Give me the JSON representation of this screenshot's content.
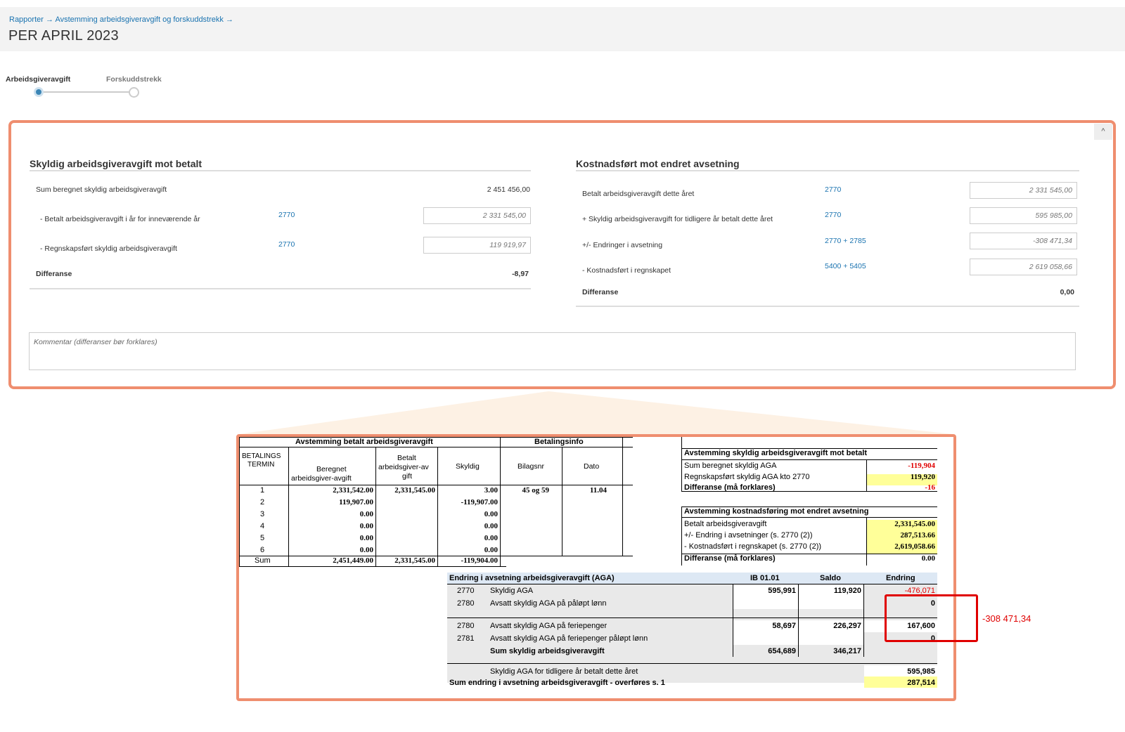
{
  "breadcrumb": {
    "item1": "Rapporter",
    "item2": "Avstemming arbeidsgiveravgift og forskuddstrekk",
    "arrow": "→"
  },
  "page_title": "PER APRIL 2023",
  "steps": [
    {
      "label": "Arbeidsgiveravgift",
      "active": true
    },
    {
      "label": "Forskuddstrekk",
      "active": false
    }
  ],
  "left_section": {
    "title": "Skyldig arbeidsgiveravgift mot betalt",
    "rows": [
      {
        "label": "Sum beregnet skyldig arbeidsgiveravgift",
        "account": "",
        "value": "2 451 456,00"
      },
      {
        "label": "- Betalt arbeidsgiveravgift i år for inneværende år",
        "account": "2770",
        "value": "2 331 545,00"
      },
      {
        "label": "- Regnskapsført skyldig arbeidsgiveravgift",
        "account": "2770",
        "value": "119 919,97"
      },
      {
        "label": "Differanse",
        "account": "",
        "value": "-8,97"
      }
    ]
  },
  "right_section": {
    "title": "Kostnadsført mot endret avsetning",
    "rows": [
      {
        "label": "Betalt arbeidsgiveravgift dette året",
        "account": "2770",
        "value": "2 331 545,00"
      },
      {
        "label": "+ Skyldig arbeidsgiveravgift for tidligere år betalt dette året",
        "account": "2770",
        "value": "595 985,00"
      },
      {
        "label": "+/- Endringer i avsetning",
        "account": "2770 + 2785",
        "value": "-308 471,34"
      },
      {
        "label": "- Kostnadsført i regnskapet",
        "account": "5400 + 5405",
        "value": "2 619 058,66"
      },
      {
        "label": "Differanse",
        "account": "",
        "value": "0,00"
      }
    ]
  },
  "comment_placeholder": "Kommentar (differanser bør forklares)",
  "collapse_icon": "^",
  "sheet": {
    "hdr_avst": "Avstemming betalt arbeidsgiveravgift",
    "hdr_bet": "Betalingsinfo",
    "col_termin_1": "BETALINGS",
    "col_termin_2": "TERMIN",
    "col_beregnet_1": "Beregnet",
    "col_beregnet_2": "arbeidsgiver-avgift",
    "col_betalt_1": "Betalt",
    "col_betalt_2": "arbeidsgiver-av",
    "col_betalt_3": "gift",
    "col_skyldig": "Skyldig",
    "col_bilag": "Bilagsnr",
    "col_dato": "Dato",
    "rows": [
      {
        "t": "1",
        "b": "2,331,542.00",
        "p": "2,331,545.00",
        "s": "3.00",
        "bil": "45 og 59",
        "d": "11.04"
      },
      {
        "t": "2",
        "b": "119,907.00",
        "p": "",
        "s": "-119,907.00",
        "bil": "",
        "d": ""
      },
      {
        "t": "3",
        "b": "0.00",
        "p": "",
        "s": "0.00",
        "bil": "",
        "d": ""
      },
      {
        "t": "4",
        "b": "0.00",
        "p": "",
        "s": "0.00",
        "bil": "",
        "d": ""
      },
      {
        "t": "5",
        "b": "0.00",
        "p": "",
        "s": "0.00",
        "bil": "",
        "d": ""
      },
      {
        "t": "6",
        "b": "0.00",
        "p": "",
        "s": "0.00",
        "bil": "",
        "d": ""
      }
    ],
    "sum": {
      "t": "Sum",
      "b": "2,451,449.00",
      "p": "2,331,545.00",
      "s": "-119,904.00"
    },
    "r1_title": "Avstemming skyldig arbeidsgiveravgift mot betalt",
    "r1_rows": [
      {
        "l": "Sum beregnet skyldig AGA",
        "v": "-119,904"
      },
      {
        "l": "Regnskapsført skyldig AGA kto 2770",
        "v": "119,920"
      },
      {
        "l": "Differanse  (må forklares)",
        "v": "-16"
      }
    ],
    "r2_title": "Avstemming kostnadsføring mot endret avsetning",
    "r2_rows": [
      {
        "l": "Betalt arbeidsgiveravgift",
        "v": "2,331,545.00"
      },
      {
        "l": "+/- Endring i avsetninger (s. 2770 (2))",
        "v": "287,513.66"
      },
      {
        "l": "-    Kostnadsført i regnskapet (s. 2770 (2))",
        "v": "2,619,058.66"
      },
      {
        "l": "Differanse  (må forklares)",
        "v": "0.00"
      }
    ],
    "e_title": "Endring i avsetning arbeidsgiveravgift (AGA)",
    "e_ib": "IB 01.01",
    "e_saldo": "Saldo",
    "e_endring": "Endring",
    "e_rows": [
      {
        "k": "2770",
        "l": "Skyldig AGA",
        "ib": "595,991",
        "s": "119,920",
        "e": "-476,071"
      },
      {
        "k": "2780",
        "l": "Avsatt skyldig AGA på påløpt lønn",
        "ib": "",
        "s": "",
        "e": "0"
      },
      {
        "k": "2780",
        "l": "Avsatt skyldig AGA på feriepenger",
        "ib": "58,697",
        "s": "226,297",
        "e": "167,600"
      },
      {
        "k": "2781",
        "l": "Avsatt skyldig AGA på feriepenger påløpt lønn",
        "ib": "",
        "s": "",
        "e": "0"
      }
    ],
    "e_sum": {
      "l": "Sum skyldig arbeidsgiveravgift",
      "ib": "654,689",
      "s": "346,217"
    },
    "e_prev": {
      "l": "Skyldig AGA for tidligere år betalt dette året",
      "v": "595,985"
    },
    "e_total": {
      "l": "Sum endring i avsetning arbeidsgiveravgift - overføres s. 1",
      "v": "287,514"
    }
  },
  "annotation": "-308 471,34",
  "colors": {
    "accent": "#1a73b0",
    "highlight_border": "#ef8e6f",
    "annotation": "#e00000",
    "yellow": "#ffff99"
  }
}
